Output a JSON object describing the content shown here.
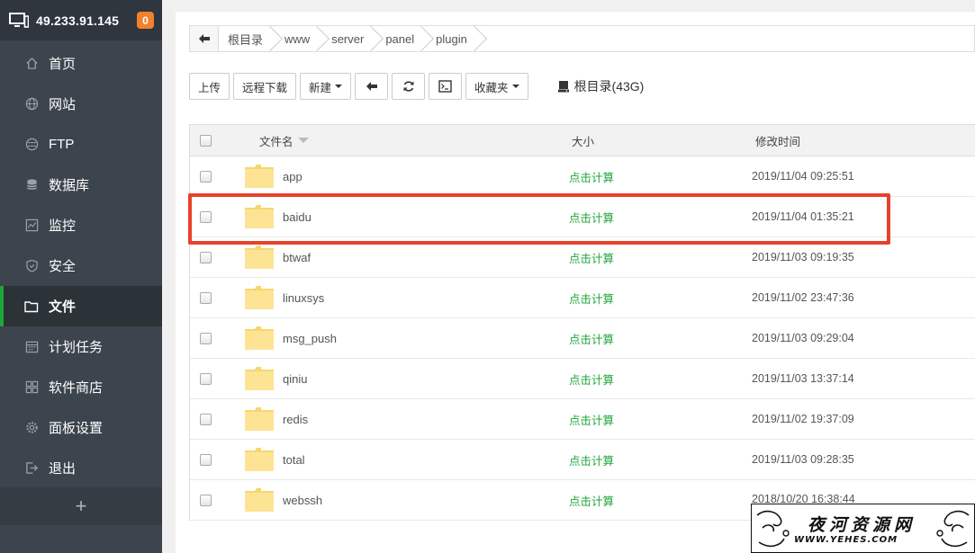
{
  "sidebar": {
    "server_ip": "49.233.91.145",
    "notification_count": "0",
    "items": [
      {
        "label": "首页",
        "icon": "home-icon"
      },
      {
        "label": "网站",
        "icon": "globe-icon"
      },
      {
        "label": "FTP",
        "icon": "ftp-icon"
      },
      {
        "label": "数据库",
        "icon": "database-icon"
      },
      {
        "label": "监控",
        "icon": "monitor-chart-icon"
      },
      {
        "label": "安全",
        "icon": "shield-icon"
      },
      {
        "label": "文件",
        "icon": "folder-icon",
        "active": true
      },
      {
        "label": "计划任务",
        "icon": "calendar-icon"
      },
      {
        "label": "软件商店",
        "icon": "grid-icon"
      },
      {
        "label": "面板设置",
        "icon": "gear-icon"
      },
      {
        "label": "退出",
        "icon": "logout-icon"
      }
    ],
    "add_label": "+"
  },
  "breadcrumb": [
    "根目录",
    "www",
    "server",
    "panel",
    "plugin"
  ],
  "toolbar": {
    "upload": "上传",
    "remote_download": "远程下载",
    "new": "新建",
    "favorites": "收藏夹",
    "disk_label": "根目录(43G)"
  },
  "table": {
    "headers": {
      "name": "文件名",
      "size": "大小",
      "modified": "修改时间"
    },
    "rows": [
      {
        "name": "app",
        "size": "点击计算",
        "modified": "2019/11/04 09:25:51"
      },
      {
        "name": "baidu",
        "size": "点击计算",
        "modified": "2019/11/04 01:35:21"
      },
      {
        "name": "btwaf",
        "size": "点击计算",
        "modified": "2019/11/03 09:19:35"
      },
      {
        "name": "linuxsys",
        "size": "点击计算",
        "modified": "2019/11/02 23:47:36"
      },
      {
        "name": "msg_push",
        "size": "点击计算",
        "modified": "2019/11/03 09:29:04"
      },
      {
        "name": "qiniu",
        "size": "点击计算",
        "modified": "2019/11/03 13:37:14"
      },
      {
        "name": "redis",
        "size": "点击计算",
        "modified": "2019/11/02 19:37:09"
      },
      {
        "name": "total",
        "size": "点击计算",
        "modified": "2019/11/03 09:28:35"
      },
      {
        "name": "webssh",
        "size": "点击计算",
        "modified": "2018/10/20 16:38:44"
      }
    ]
  },
  "watermark": {
    "title": "夜河资源网",
    "url": "WWW.YEHES.COM"
  },
  "colors": {
    "accent": "#20a53a",
    "highlight": "#e8412b",
    "sidebar": "#3c444d",
    "badge": "#f0812e"
  }
}
